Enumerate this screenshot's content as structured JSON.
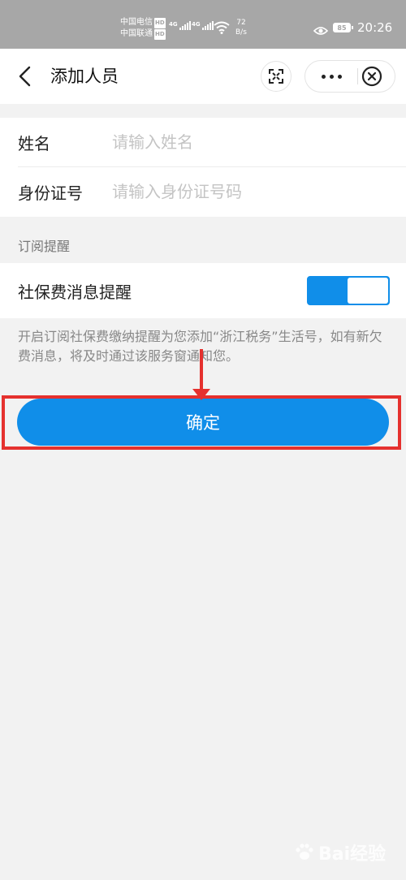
{
  "status_bar": {
    "carrier_1": "中国电信",
    "carrier_2": "中国联通",
    "hd_badge": "HD",
    "network_1": "4G",
    "network_2": "4G",
    "speed_value": "72",
    "speed_unit": "B/s",
    "battery": "85",
    "time": "20:26"
  },
  "nav": {
    "title": "添加人员",
    "icons": [
      "back-icon",
      "scan-icon",
      "more-icon",
      "close-icon"
    ]
  },
  "form": {
    "name": {
      "label": "姓名",
      "placeholder": "请输入姓名",
      "value": ""
    },
    "id_number": {
      "label": "身份证号",
      "placeholder": "请输入身份证号码",
      "value": ""
    }
  },
  "subscription": {
    "section_title": "订阅提醒",
    "toggle_label": "社保费消息提醒",
    "toggle_on": true,
    "note": "开启订阅社保费缴纳提醒为您添加“浙江税务”生活号，如有新欠费消息，将及时通过该服务窗通知您。"
  },
  "confirm_button": {
    "label": "确定"
  },
  "watermark": {
    "text": "Bai经验"
  },
  "colors": {
    "accent": "#108ee9",
    "annotation": "#e5312e",
    "status_bar_bg": "#a7a7a7",
    "page_bg": "#f2f2f2"
  }
}
